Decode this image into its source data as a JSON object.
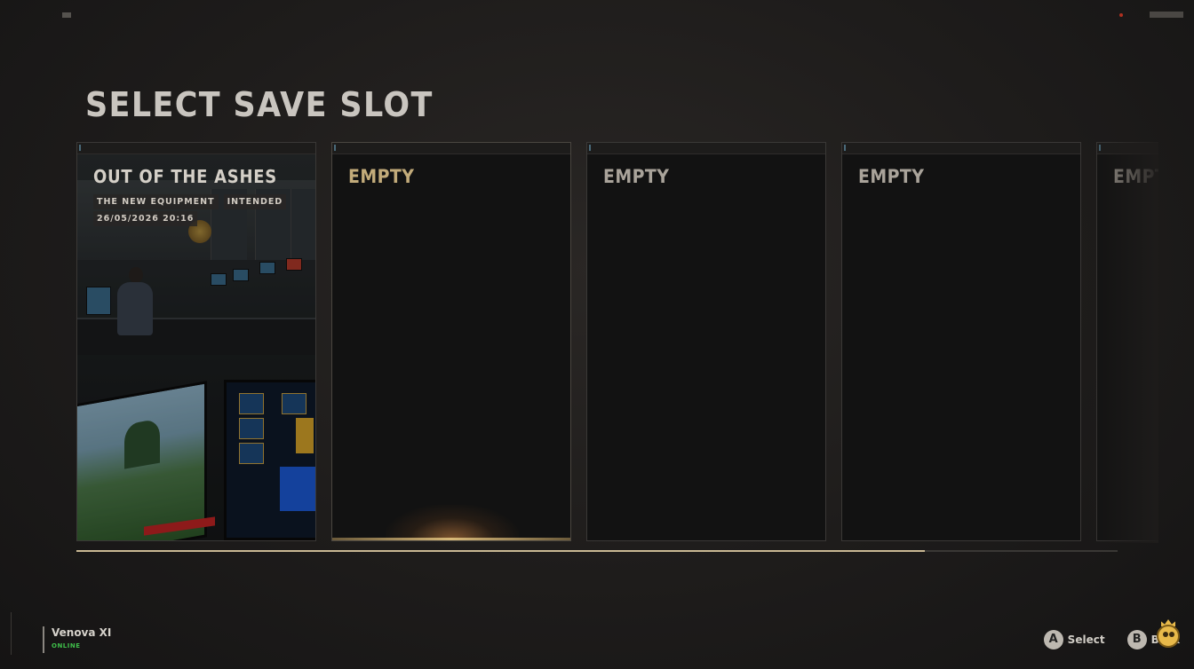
{
  "page": {
    "title": "SELECT SAVE SLOT"
  },
  "slots": [
    {
      "state": "filled",
      "title": "OUT OF THE ASHES",
      "tags": [
        "THE NEW EQUIPMENT",
        "INTENDED"
      ],
      "date": "26/05/2026 20:16"
    },
    {
      "state": "empty",
      "title": "EMPTY"
    },
    {
      "state": "empty",
      "title": "EMPTY"
    },
    {
      "state": "empty",
      "title": "EMPTY"
    },
    {
      "state": "empty",
      "title": "EMPTY"
    }
  ],
  "progress": {
    "fraction": 0.815
  },
  "user": {
    "name": "Venova XI",
    "status": "ONLINE"
  },
  "prompts": [
    {
      "key": "A",
      "label": "Select"
    },
    {
      "key": "B",
      "label": "Back"
    }
  ],
  "colors": {
    "accent": "#c9b893",
    "online": "#3fbf4a",
    "active_title": "#c2ab7a"
  },
  "icons": [
    "mascot-avatar-icon"
  ]
}
